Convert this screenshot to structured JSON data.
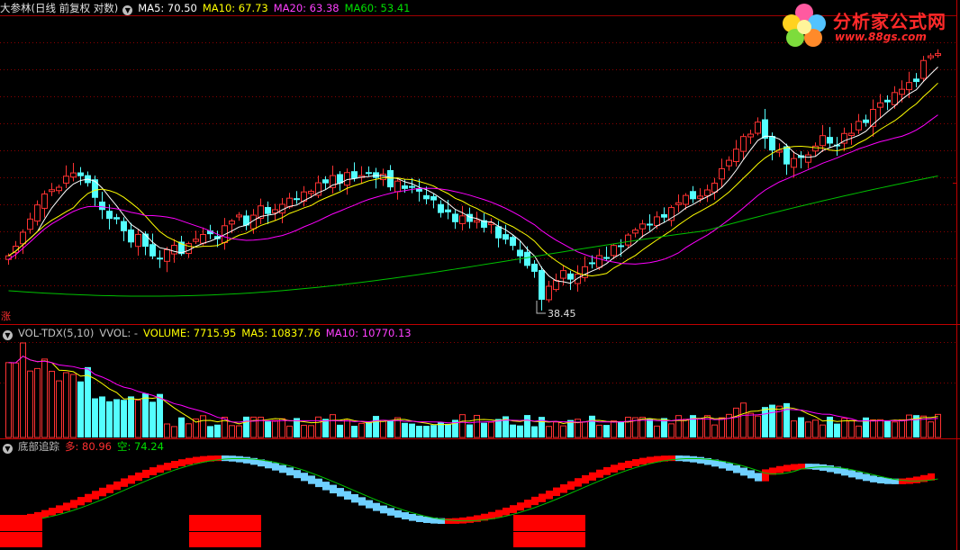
{
  "main": {
    "title": "大参林(日线 前复权 对数)",
    "ma5": "MA5: 70.50",
    "ma10": "MA10: 67.73",
    "ma20": "MA20: 63.38",
    "ma60": "MA60: 53.41",
    "low_label": "38.45",
    "side_label": "涨"
  },
  "volume": {
    "title": "VOL-TDX(5,10)",
    "vvol": "VVOL: -",
    "volume": "VOLUME: 7715.95",
    "ma5": "MA5: 10837.76",
    "ma10": "MA10: 10770.13"
  },
  "indicator": {
    "title": "底部追踪",
    "duo": "多: 80.96",
    "kong": "空: 74.24"
  },
  "logo": {
    "title": "分析家公式网",
    "url": "www.88gs.com"
  },
  "colors": {
    "up": "#ff3232",
    "down": "#54ffff",
    "ma5": "#ffffff",
    "ma10": "#ffff00",
    "ma20": "#ff00ff",
    "ma60": "#00c000",
    "grid": "#8b0000",
    "red_block": "#ff0000",
    "blue_step": "#6fd0ff"
  },
  "chart_data": [
    {
      "type": "candlestick",
      "title": "大参林(日线 前复权 对数)",
      "series_legend": [
        "MA5",
        "MA10",
        "MA20",
        "MA60"
      ],
      "annotations": [
        {
          "label": "38.45",
          "value": 38.45
        }
      ],
      "notes": "Daily candles with MA5/MA10/MA20/MA60 overlays; price falls to a low of 38.45 then rallies toward ~70; values approximated from shape"
    },
    {
      "type": "bar",
      "title": "VOL-TDX(5,10)",
      "series_legend": [
        "VOLUME",
        "MA5",
        "MA10"
      ],
      "values_summary": {
        "VOLUME": 7715.95,
        "MA5": 10837.76,
        "MA10": 10770.13
      }
    },
    {
      "type": "line",
      "title": "底部追踪",
      "series_legend": [
        "多",
        "空"
      ],
      "values_summary": {
        "多": 80.96,
        "空": 74.24
      }
    }
  ]
}
